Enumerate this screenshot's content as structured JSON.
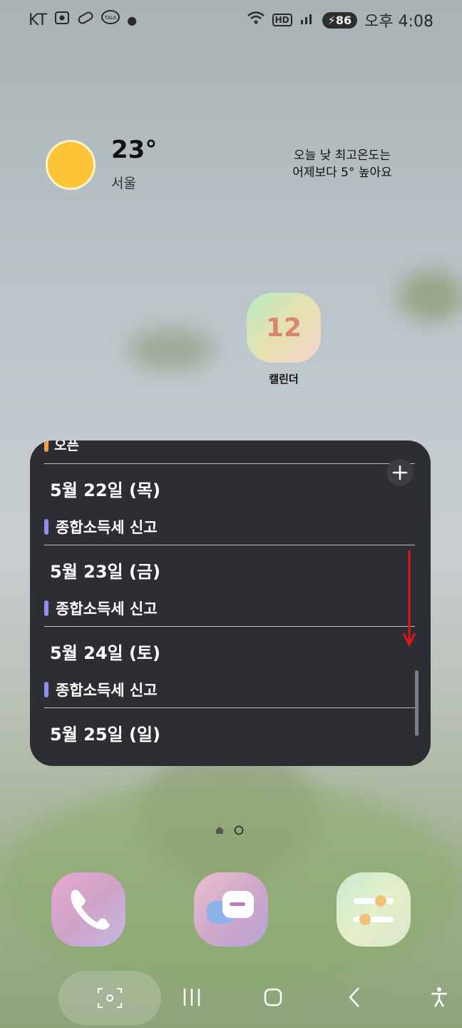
{
  "status_bar": {
    "carrier": "KT",
    "talk_badge": "TALK",
    "hd_badge": "HD",
    "battery": "86",
    "time": "오후 4:08"
  },
  "weather": {
    "temperature": "23°",
    "city": "서울",
    "forecast_line1": "오늘 낮 최고온도는",
    "forecast_line2": "어제보다 5° 높아요",
    "icon": "sun-icon"
  },
  "home_apps": [
    {
      "label": "캘린더",
      "badge": "12",
      "icon": "calendar-icon"
    }
  ],
  "calendar_widget": {
    "partial_top_event": "오픈",
    "days": [
      {
        "date": "5월 22일 (목)",
        "event": "종합소득세 신고"
      },
      {
        "date": "5월 23일 (금)",
        "event": "종합소득세 신고"
      },
      {
        "date": "5월 24일 (토)",
        "event": "종합소득세 신고"
      },
      {
        "date": "5월 25일 (일)"
      }
    ],
    "colors": {
      "event_bar": "#8c8ff0",
      "top_event_bar": "#f0a24e",
      "arrow": "#e0141b"
    }
  },
  "dock": [
    {
      "name": "phone-app",
      "icon": "phone-icon"
    },
    {
      "name": "messages-app",
      "icon": "message-icon"
    },
    {
      "name": "settings-app",
      "icon": "settings-icon"
    }
  ],
  "nav_bar": {
    "buttons": [
      "screenshot-capture",
      "recents",
      "home",
      "back",
      "accessibility"
    ]
  }
}
